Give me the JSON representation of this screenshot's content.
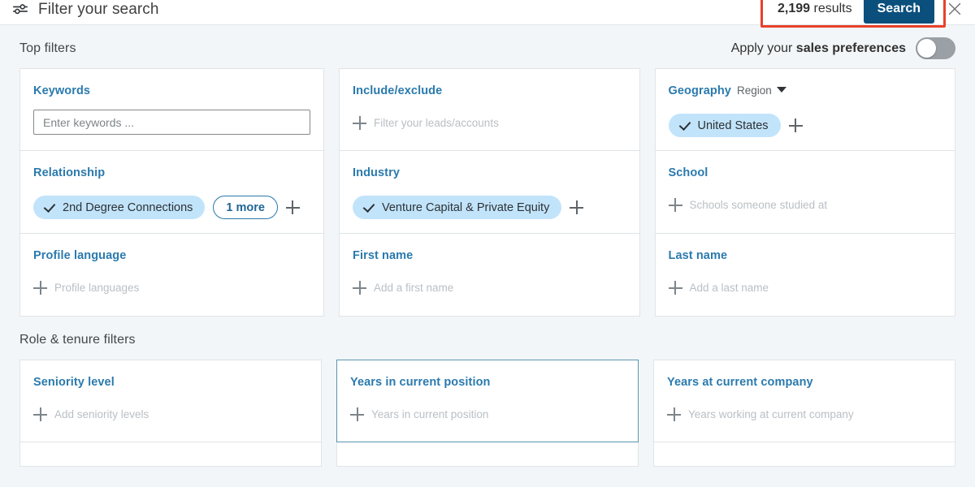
{
  "header": {
    "filter_icon": "sliders-icon",
    "title": "Filter your search",
    "results_count": "2,199",
    "results_label": "results",
    "search_label": "Search",
    "close_icon": "close-icon"
  },
  "top_filters": {
    "section_title": "Top filters",
    "preferences_prefix": "Apply your ",
    "preferences_bold": "sales preferences",
    "toggle_state": "off",
    "cards": [
      {
        "title": "Keywords",
        "input_placeholder": "Enter keywords ...",
        "kind": "input"
      },
      {
        "title": "Include/exclude",
        "placeholder": "Filter your leads/accounts",
        "kind": "placeholder"
      },
      {
        "title": "Geography",
        "subtitle": "Region",
        "pills": [
          "United States"
        ],
        "kind": "pills"
      },
      {
        "title": "Relationship",
        "pills": [
          "2nd Degree Connections"
        ],
        "more_label": "1 more",
        "kind": "pills"
      },
      {
        "title": "Industry",
        "pills": [
          "Venture Capital & Private Equity"
        ],
        "kind": "pills"
      },
      {
        "title": "School",
        "placeholder": "Schools someone studied at",
        "kind": "placeholder"
      },
      {
        "title": "Profile language",
        "placeholder": "Profile languages",
        "kind": "placeholder"
      },
      {
        "title": "First name",
        "placeholder": "Add a first name",
        "kind": "placeholder"
      },
      {
        "title": "Last name",
        "placeholder": "Add a last name",
        "kind": "placeholder"
      }
    ]
  },
  "role_tenure_filters": {
    "section_title": "Role & tenure filters",
    "cards": [
      {
        "title": "Seniority level",
        "placeholder": "Add seniority levels",
        "active": false
      },
      {
        "title": "Years in current position",
        "placeholder": "Years in current position",
        "active": true
      },
      {
        "title": "Years at current company",
        "placeholder": "Years working at current company",
        "active": false
      }
    ]
  },
  "colors": {
    "accent_blue": "#2a7aad",
    "search_button": "#0b4f7d",
    "pill_bg": "#c2e4fb",
    "annotation_red": "#e8412a",
    "page_bg": "#f3f6f8"
  }
}
